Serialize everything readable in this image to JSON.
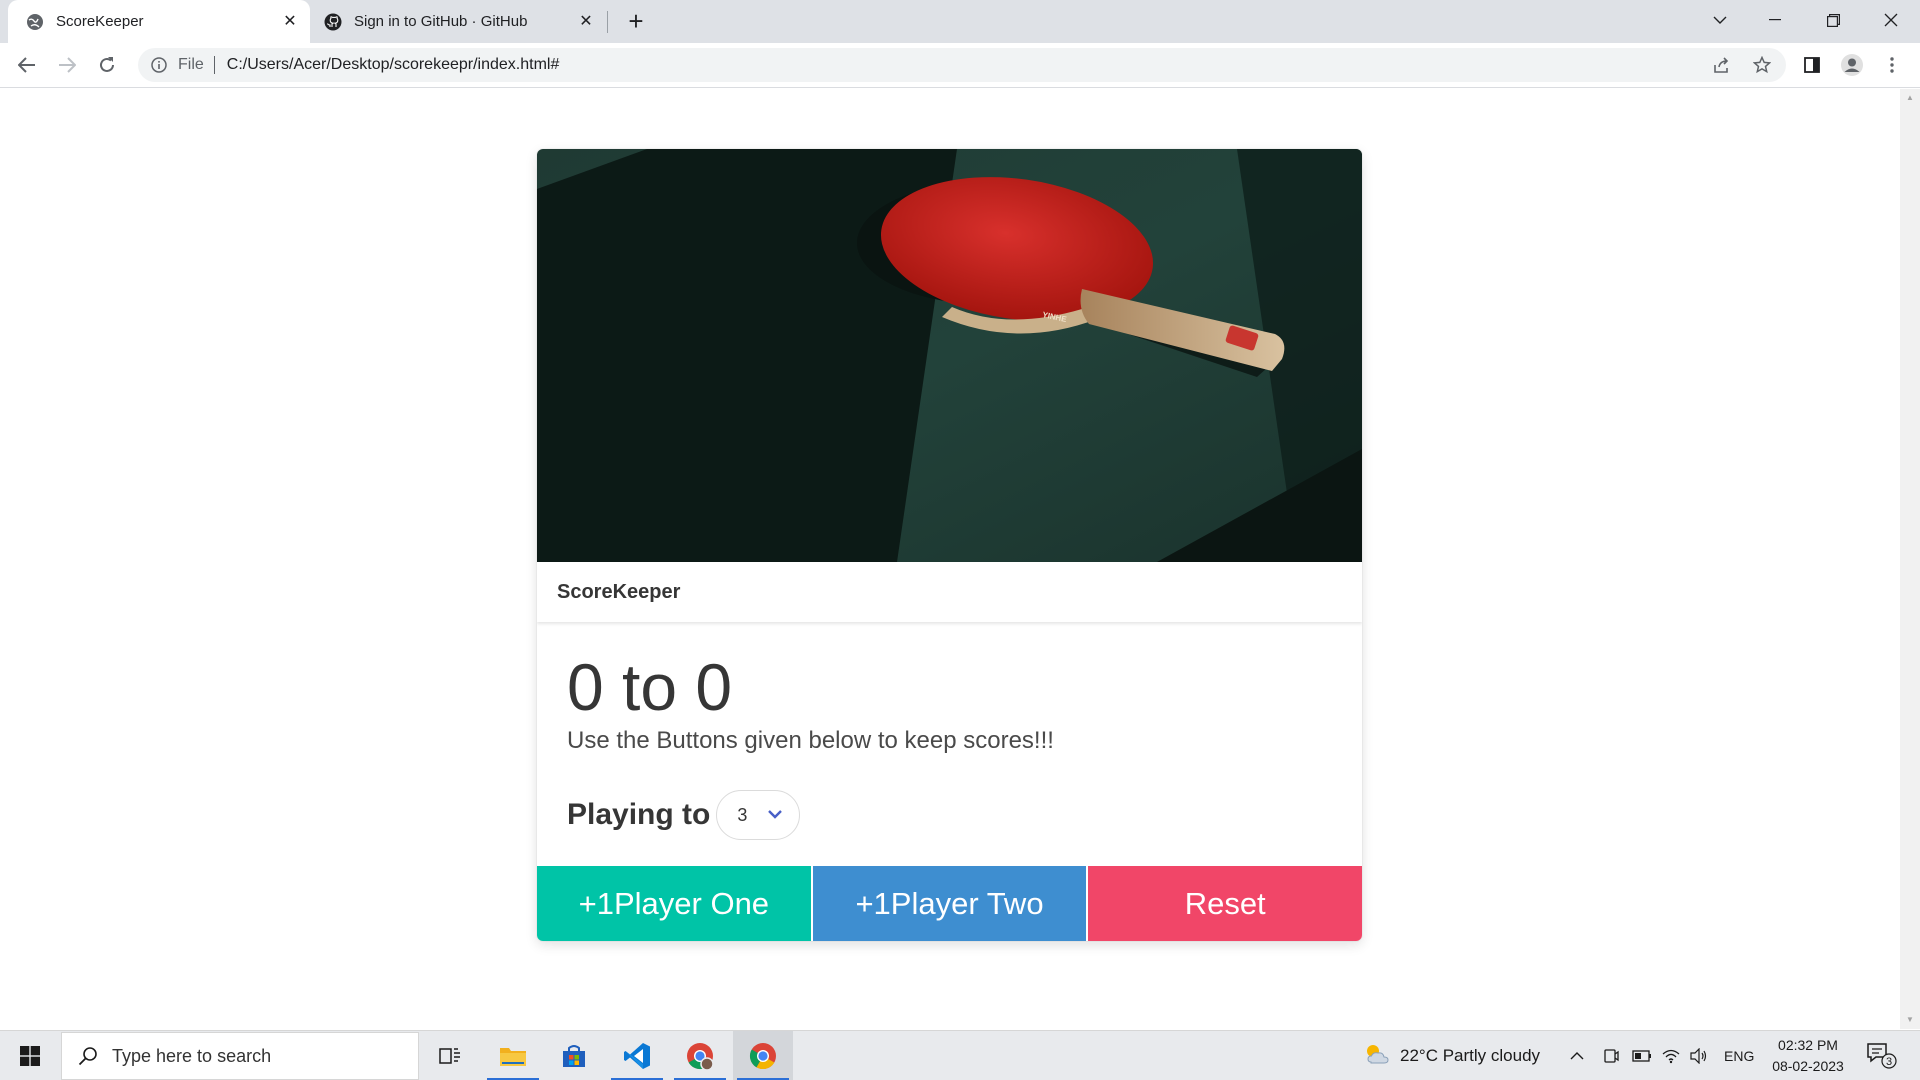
{
  "browser": {
    "tabs": [
      {
        "title": "ScoreKeeper",
        "active": true
      },
      {
        "title": "Sign in to GitHub · GitHub",
        "active": false
      }
    ],
    "url_scheme_label": "File",
    "url": "C:/Users/Acer/Desktop/scorekeepr/index.html#"
  },
  "app": {
    "card_title": "ScoreKeeper",
    "score": "0 to 0",
    "subtitle": "Use the Buttons given below to keep scores!!!",
    "playing_to_label": "Playing to",
    "playing_to_value": "3",
    "buttons": {
      "player_one": "+1Player One",
      "player_two": "+1Player Two",
      "reset": "Reset"
    },
    "colors": {
      "player_one": "#00c4a7",
      "player_two": "#3e8ed0",
      "reset": "#f14668"
    }
  },
  "taskbar": {
    "search_placeholder": "Type here to search",
    "weather": "22°C  Partly cloudy",
    "language": "ENG",
    "time": "02:32 PM",
    "date": "08-02-2023",
    "notification_count": "3",
    "pinned": [
      "task-view-icon",
      "file-explorer-icon",
      "microsoft-store-icon",
      "vscode-icon",
      "chrome-profile-icon",
      "chrome-icon"
    ]
  }
}
